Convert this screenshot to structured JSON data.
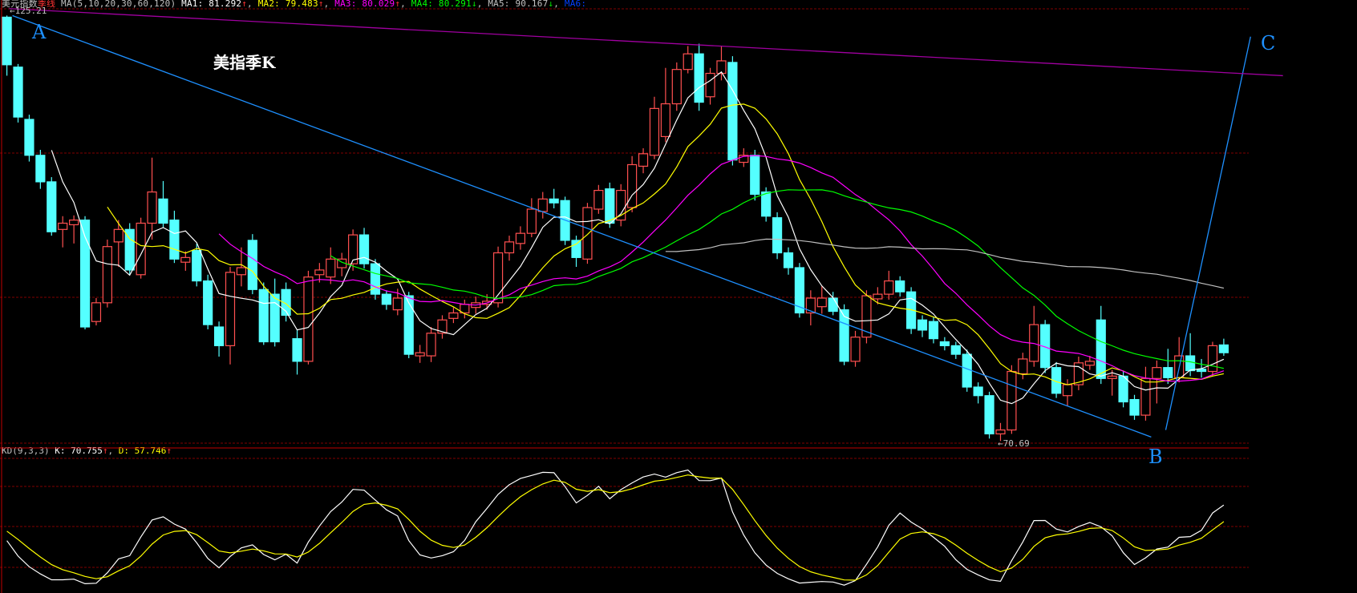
{
  "header": {
    "instrument": "美元指数",
    "period": "季线",
    "ma_params": "MA(5,10,20,30,60,120)",
    "ma": [
      {
        "label": "MA1:",
        "value": "81.292",
        "arrow": "↑",
        "color": "#ffffff"
      },
      {
        "label": "MA2:",
        "value": "79.483",
        "arrow": "↑",
        "color": "#ffff00"
      },
      {
        "label": "MA3:",
        "value": "80.029",
        "arrow": "↑",
        "color": "#ff00ff"
      },
      {
        "label": "MA4:",
        "value": "80.291",
        "arrow": "↓",
        "color": "#00ff00"
      },
      {
        "label": "MA5:",
        "value": "90.167",
        "arrow": "↓",
        "color": "#c0c0c0"
      },
      {
        "label": "MA6:",
        "value": "",
        "arrow": "",
        "color": "#0040ff"
      }
    ]
  },
  "kd_header": {
    "name": "KD(9,3,3)",
    "k_label": "K:",
    "k_value": "70.755",
    "k_arrow": "↑",
    "d_label": "D:",
    "d_value": "57.746",
    "d_arrow": "↑"
  },
  "annotations": {
    "title": "美指季K",
    "label_a": "A",
    "label_b": "B",
    "label_c": "C",
    "max_marker": "←125.21",
    "min_marker": "←70.69"
  },
  "colors": {
    "up": "#ff5050",
    "down": "#54ffff",
    "grid": "#800000",
    "ma": [
      "#ffffff",
      "#ffff00",
      "#ff00ff",
      "#00ff00",
      "#c0c0c0",
      "#0040ff"
    ],
    "k": "#ffffff",
    "d": "#ffff00",
    "trendline": "#1e90ff",
    "channel": "#a000a0"
  },
  "chart_data": {
    "type": "candlestick",
    "ma_periods": [
      5,
      10,
      20,
      30,
      60,
      120
    ],
    "kd_params": [
      9,
      3,
      3
    ],
    "kd_range": [
      0,
      100
    ],
    "price_high": 125.21,
    "price_low": 70.69,
    "fields": [
      "open",
      "high",
      "low",
      "close"
    ],
    "ohlc": [
      [
        125.0,
        125.21,
        117.5,
        118.9
      ],
      [
        118.6,
        119.0,
        111.5,
        112.2
      ],
      [
        111.9,
        112.5,
        106.5,
        107.3
      ],
      [
        107.3,
        108.0,
        103.0,
        103.9
      ],
      [
        103.9,
        104.5,
        97.0,
        97.5
      ],
      [
        97.8,
        99.5,
        95.5,
        98.6
      ],
      [
        98.4,
        99.6,
        96.0,
        99.0
      ],
      [
        99.0,
        99.5,
        85.0,
        85.3
      ],
      [
        86.0,
        89.0,
        85.5,
        88.4
      ],
      [
        88.4,
        96.5,
        87.8,
        95.6
      ],
      [
        96.2,
        99.0,
        93.0,
        97.8
      ],
      [
        97.8,
        98.6,
        92.0,
        92.6
      ],
      [
        92.0,
        99.3,
        91.5,
        98.6
      ],
      [
        98.6,
        107.0,
        96.5,
        102.6
      ],
      [
        101.7,
        104.0,
        98.0,
        98.6
      ],
      [
        99.0,
        100.2,
        93.5,
        94.0
      ],
      [
        93.6,
        95.0,
        92.5,
        94.2
      ],
      [
        95.1,
        96.0,
        90.5,
        91.2
      ],
      [
        91.2,
        92.0,
        85.0,
        85.6
      ],
      [
        85.3,
        86.0,
        81.5,
        82.9
      ],
      [
        82.9,
        93.0,
        80.5,
        92.3
      ],
      [
        92.0,
        95.5,
        90.5,
        92.9
      ],
      [
        96.4,
        97.2,
        89.5,
        90.1
      ],
      [
        90.1,
        91.0,
        83.0,
        83.4
      ],
      [
        89.5,
        91.5,
        82.8,
        83.4
      ],
      [
        90.1,
        91.0,
        86.0,
        86.8
      ],
      [
        83.8,
        85.0,
        79.2,
        80.9
      ],
      [
        80.9,
        92.5,
        80.5,
        91.7
      ],
      [
        92.0,
        93.5,
        91.0,
        92.6
      ],
      [
        91.7,
        95.5,
        90.8,
        94.0
      ],
      [
        92.9,
        94.8,
        91.8,
        94.0
      ],
      [
        93.4,
        97.8,
        92.5,
        97.1
      ],
      [
        97.1,
        98.0,
        92.8,
        93.4
      ],
      [
        93.4,
        94.0,
        88.8,
        89.5
      ],
      [
        89.5,
        90.0,
        87.5,
        88.2
      ],
      [
        87.5,
        90.2,
        86.8,
        89.0
      ],
      [
        89.3,
        89.8,
        81.3,
        81.8
      ],
      [
        81.6,
        83.0,
        80.7,
        82.0
      ],
      [
        81.6,
        85.3,
        80.8,
        84.5
      ],
      [
        84.5,
        86.8,
        83.8,
        86.2
      ],
      [
        86.4,
        87.8,
        85.8,
        87.1
      ],
      [
        87.1,
        88.8,
        86.4,
        88.2
      ],
      [
        87.8,
        89.2,
        87.0,
        88.4
      ],
      [
        88.2,
        89.5,
        87.5,
        88.6
      ],
      [
        88.4,
        95.6,
        87.8,
        94.8
      ],
      [
        94.8,
        97.0,
        93.8,
        96.2
      ],
      [
        96.0,
        98.2,
        95.2,
        97.3
      ],
      [
        97.3,
        101.8,
        96.8,
        100.4
      ],
      [
        100.1,
        102.6,
        99.2,
        101.7
      ],
      [
        101.7,
        103.0,
        100.5,
        101.2
      ],
      [
        101.5,
        102.0,
        95.8,
        96.4
      ],
      [
        96.4,
        97.0,
        93.0,
        94.2
      ],
      [
        94.0,
        101.2,
        93.4,
        100.6
      ],
      [
        100.4,
        103.5,
        99.8,
        102.8
      ],
      [
        103.0,
        103.8,
        98.0,
        98.6
      ],
      [
        99.0,
        103.6,
        98.2,
        102.8
      ],
      [
        100.6,
        107.2,
        100.0,
        106.1
      ],
      [
        105.9,
        108.2,
        105.0,
        107.5
      ],
      [
        107.3,
        114.8,
        106.8,
        113.3
      ],
      [
        109.7,
        118.5,
        109.0,
        113.9
      ],
      [
        113.9,
        119.2,
        113.0,
        118.3
      ],
      [
        118.3,
        121.3,
        117.8,
        120.3
      ],
      [
        120.3,
        121.6,
        113.0,
        114.1
      ],
      [
        114.8,
        118.5,
        113.8,
        117.8
      ],
      [
        117.8,
        121.3,
        116.9,
        119.4
      ],
      [
        119.2,
        120.0,
        106.0,
        106.7
      ],
      [
        106.4,
        108.2,
        105.8,
        107.3
      ],
      [
        107.3,
        108.0,
        101.5,
        102.3
      ],
      [
        102.6,
        103.2,
        98.8,
        99.5
      ],
      [
        99.3,
        100.0,
        94.0,
        94.8
      ],
      [
        94.8,
        95.5,
        92.0,
        92.9
      ],
      [
        92.9,
        93.5,
        86.5,
        87.1
      ],
      [
        87.1,
        90.0,
        85.5,
        89.0
      ],
      [
        87.9,
        90.5,
        87.0,
        89.0
      ],
      [
        89.0,
        89.8,
        86.8,
        87.3
      ],
      [
        87.5,
        88.2,
        80.4,
        80.9
      ],
      [
        80.9,
        84.8,
        80.2,
        84.0
      ],
      [
        84.0,
        90.0,
        83.2,
        89.3
      ],
      [
        88.9,
        90.4,
        88.2,
        89.5
      ],
      [
        89.5,
        92.5,
        88.8,
        91.2
      ],
      [
        91.2,
        91.8,
        89.2,
        89.8
      ],
      [
        89.8,
        90.4,
        84.4,
        85.1
      ],
      [
        86.2,
        86.8,
        84.0,
        84.9
      ],
      [
        86.0,
        86.6,
        83.2,
        83.8
      ],
      [
        83.4,
        84.0,
        82.3,
        82.9
      ],
      [
        82.9,
        83.4,
        81.2,
        81.8
      ],
      [
        81.8,
        82.4,
        77.0,
        77.6
      ],
      [
        77.6,
        78.2,
        75.5,
        76.5
      ],
      [
        76.5,
        77.0,
        71.0,
        71.6
      ],
      [
        71.6,
        73.0,
        70.69,
        72.1
      ],
      [
        72.1,
        80.4,
        71.6,
        79.6
      ],
      [
        79.3,
        82.0,
        78.6,
        81.2
      ],
      [
        80.9,
        88.0,
        80.2,
        85.6
      ],
      [
        85.6,
        86.2,
        79.4,
        80.1
      ],
      [
        80.1,
        80.8,
        76.2,
        76.8
      ],
      [
        76.5,
        78.6,
        75.2,
        77.9
      ],
      [
        77.9,
        81.5,
        77.2,
        80.7
      ],
      [
        80.4,
        81.6,
        79.8,
        80.9
      ],
      [
        86.2,
        88.0,
        78.0,
        78.7
      ],
      [
        78.7,
        79.8,
        76.5,
        79.0
      ],
      [
        79.0,
        79.6,
        75.0,
        75.7
      ],
      [
        76.0,
        76.6,
        73.4,
        74.0
      ],
      [
        74.0,
        80.2,
        73.3,
        78.7
      ],
      [
        78.7,
        81.0,
        75.5,
        80.1
      ],
      [
        80.1,
        82.5,
        78.0,
        78.8
      ],
      [
        78.8,
        84.0,
        78.2,
        81.6
      ],
      [
        81.6,
        84.5,
        79.0,
        79.7
      ],
      [
        79.9,
        81.2,
        78.8,
        79.6
      ],
      [
        79.6,
        83.4,
        79.0,
        82.9
      ],
      [
        83.0,
        83.8,
        81.6,
        82.0
      ]
    ],
    "trendlines": [
      {
        "name": "A-B",
        "from": [
          0.5,
          125.2
        ],
        "to": [
          102.5,
          71.2
        ]
      },
      {
        "name": "B-C",
        "from": [
          103.8,
          72.1
        ],
        "to": [
          111.4,
          122.5
        ]
      },
      {
        "name": "channel",
        "from": [
          0.2,
          126.1
        ],
        "to": [
          114.3,
          117.5
        ]
      }
    ]
  }
}
